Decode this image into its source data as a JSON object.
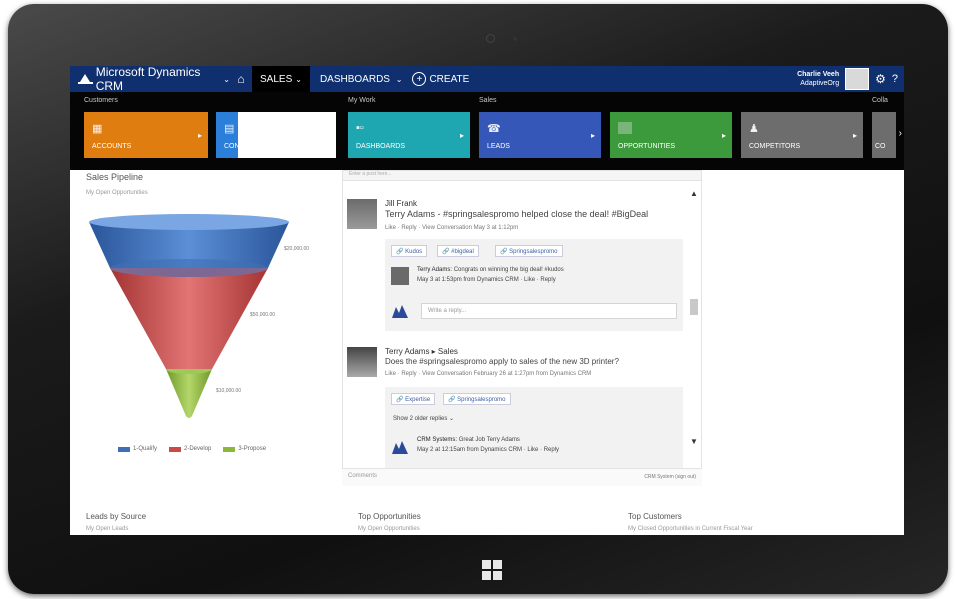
{
  "navbar": {
    "app_title": "Microsoft Dynamics CRM",
    "sales_tab": "SALES",
    "dashboards_tab": "DASHBOARDS",
    "create_label": "CREATE",
    "user_name": "Charlie Veeh",
    "user_org": "AdaptiveOrg"
  },
  "ribbon": {
    "groups": {
      "customers": "Customers",
      "my_work": "My Work",
      "sales": "Sales",
      "collateral": "Colla"
    },
    "tiles": {
      "accounts": "ACCOUNTS",
      "contacts": "CONTACTS",
      "dashboards": "DASHBOARDS",
      "leads": "LEADS",
      "opportunities": "OPPORTUNITIES",
      "competitors": "COMPETITORS",
      "next": "CO"
    }
  },
  "funnel_panel": {
    "title": "Sales Pipeline",
    "subtitle": "My Open Opportunities",
    "values": [
      "$20,000.00",
      "$50,000.00",
      "$10,000.00"
    ],
    "legend": [
      "1-Qualify",
      "2-Develop",
      "3-Propose"
    ],
    "colors": {
      "qualify": "#3d6eb8",
      "develop": "#c94a4a",
      "propose": "#8cb83a"
    }
  },
  "chart_data": {
    "type": "funnel",
    "title": "Sales Pipeline",
    "categories": [
      "1-Qualify",
      "2-Develop",
      "3-Propose"
    ],
    "values": [
      20000,
      50000,
      10000
    ]
  },
  "feed": {
    "top_hint": "Enter a post here...",
    "post1": {
      "name": "Jill Frank",
      "message": "Terry Adams - #springsalespromo helped close the deal! #BigDeal",
      "meta": "Like · Reply · View Conversation  May 3 at 1:12pm",
      "tags": [
        "Kudos",
        "#bigdeal",
        "Springsalespromo"
      ],
      "reply_name": "Terry Adams:",
      "reply_text": "Congrats on winning the big deal! #kudos",
      "reply_meta": "May 3 at 1:53pm from Dynamics CRM · Like · Reply",
      "reply_placeholder": "Write a reply..."
    },
    "post2": {
      "name": "Terry Adams ▸ Sales",
      "message": "Does the #springsalespromo apply to sales of the new 3D printer?",
      "meta": "Like · Reply · View Conversation  February 26 at 1:27pm from Dynamics CRM",
      "tags": [
        "Expertise",
        "Springsalespromo"
      ],
      "show_replies": "Show 2 older replies ⌄",
      "reply_name": "CRM Systems:",
      "reply_text": "Great Job Terry Adams",
      "reply_meta": "May 2 at 12:15am from Dynamics CRM · Like · Reply"
    },
    "footer_placeholder": "Comments",
    "footer_right": "CRM System (sign out)"
  },
  "bottom": {
    "col1_title": "Leads by Source",
    "col1_sub": "My Open Leads",
    "col2_title": "Top Opportunities",
    "col2_sub": "My Open Opportunities",
    "col3_title": "Top Customers",
    "col3_sub": "My Closed Opportunities in Current Fiscal Year"
  }
}
